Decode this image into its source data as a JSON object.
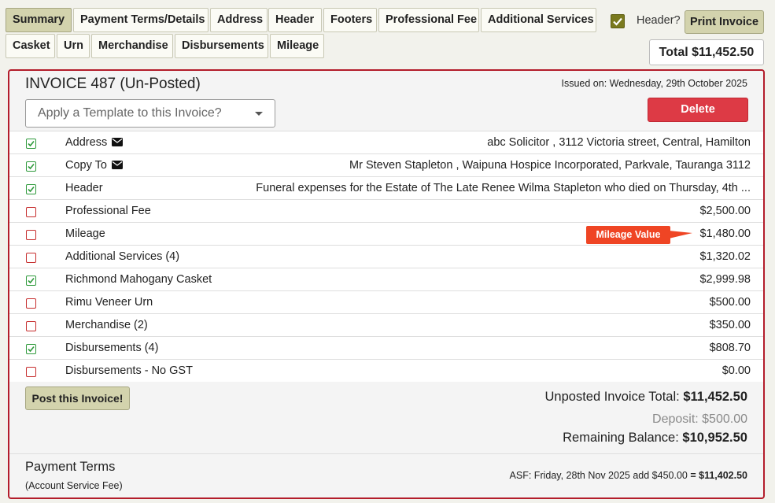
{
  "tabs_row1": [
    "Summary",
    "Payment Terms/Details",
    "Address",
    "Header",
    "Footers",
    "Professional Fee",
    "Additional Services"
  ],
  "tabs_row2": [
    "Casket",
    "Urn",
    "Merchandise",
    "Disbursements",
    "Mileage"
  ],
  "header_toggle": {
    "label": "Header?",
    "checked": true
  },
  "print_button": "Print Invoice",
  "total_badge": "Total $11,452.50",
  "invoice": {
    "title": "INVOICE 487 (Un-Posted)",
    "issued": "Issued on: Wednesday, 29th October 2025",
    "template_placeholder": "Apply a Template to this Invoice?",
    "delete_button": "Delete"
  },
  "items": [
    {
      "label": "Address",
      "checked": true,
      "envelope": true,
      "value": "abc Solicitor , 3112 Victoria street, Central, Hamilton"
    },
    {
      "label": "Copy To",
      "checked": true,
      "envelope": true,
      "value": "Mr Steven Stapleton , Waipuna Hospice Incorporated, Parkvale, Tauranga 3112"
    },
    {
      "label": "Header",
      "checked": true,
      "envelope": false,
      "value": "Funeral expenses for the Estate of The Late Renee Wilma Stapleton who died on Thursday, 4th ..."
    },
    {
      "label": "Professional Fee",
      "checked": false,
      "envelope": false,
      "value": "$2,500.00"
    },
    {
      "label": "Mileage",
      "checked": false,
      "envelope": false,
      "value": "$1,480.00"
    },
    {
      "label": "Additional Services (4)",
      "checked": false,
      "envelope": false,
      "value": "$1,320.02"
    },
    {
      "label": "Richmond Mahogany Casket",
      "checked": true,
      "envelope": false,
      "value": "$2,999.98"
    },
    {
      "label": "Rimu Veneer Urn",
      "checked": false,
      "envelope": false,
      "value": "$500.00"
    },
    {
      "label": "Merchandise (2)",
      "checked": false,
      "envelope": false,
      "value": "$350.00"
    },
    {
      "label": "Disbursements (4)",
      "checked": true,
      "envelope": false,
      "value": "$808.70"
    },
    {
      "label": "Disbursements - No GST",
      "checked": false,
      "envelope": false,
      "value": "$0.00"
    }
  ],
  "mileage_tooltip": "Mileage Value",
  "post_button": "Post this Invoice!",
  "totals": {
    "unposted_label": "Unposted Invoice Total:",
    "unposted_value": "$11,452.50",
    "deposit": "Deposit: $500.00",
    "remaining_label": "Remaining Balance:",
    "remaining_value": "$10,952.50"
  },
  "payment_terms": {
    "title": "Payment Terms",
    "subtitle": "(Account Service Fee)",
    "asf_text": "ASF: Friday, 28th Nov 2025 add $450.00",
    "asf_total": "= $11,402.50"
  },
  "colors": {
    "active_tab": "#d3d3ad",
    "panel_border": "#b31d2b",
    "delete": "#dd3a45",
    "tooltip": "#ef4524",
    "check_on": "#2f9a3c",
    "check_off": "#c62d2d"
  }
}
